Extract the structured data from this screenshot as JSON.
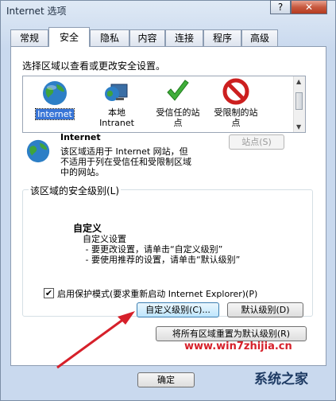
{
  "window": {
    "title": "Internet 选项",
    "help": "?",
    "close": "✕"
  },
  "tabs": [
    {
      "label": "常规"
    },
    {
      "label": "安全"
    },
    {
      "label": "隐私"
    },
    {
      "label": "内容"
    },
    {
      "label": "连接"
    },
    {
      "label": "程序"
    },
    {
      "label": "高级"
    }
  ],
  "active_tab": "安全",
  "zones": {
    "prompt": "选择区域以查看或更改安全设置。",
    "items": [
      {
        "label": "Internet",
        "icon": "globe-icon",
        "selected": true
      },
      {
        "label": "本地\nIntranet",
        "icon": "intranet-icon",
        "selected": false
      },
      {
        "label": "受信任的站\n点",
        "icon": "checkmark-icon",
        "selected": false
      },
      {
        "label": "受限制的站\n点",
        "icon": "no-entry-icon",
        "selected": false
      }
    ]
  },
  "zone_info": {
    "name": "Internet",
    "description": "该区域适用于 Internet 网站，但\n不适用于列在受信任和受限制区域\n中的网站。",
    "sites_button": "站点(S)"
  },
  "security_level": {
    "group_title": "该区域的安全级别(L)",
    "level_name": "自定义",
    "details": "自定义设置\n - 要更改设置，请单击“自定义级别”\n - 要使用推荐的设置，请单击“默认级别”",
    "protected_mode": "启用保护模式(要求重新启动 Internet Explorer)(P)",
    "protected_mode_checked": true,
    "custom_level_button": "自定义级别(C)...",
    "default_level_button": "默认级别(D)"
  },
  "reset_all_button": "将所有区域重置为默认级别(R)",
  "footer": {
    "ok_button": "确定"
  },
  "watermark": {
    "url": "www.win7zhijia.cn",
    "brand": "系统之家"
  },
  "colors": {
    "selection": "#3875d7",
    "close": "#c75a40",
    "arrow": "#d6202a"
  }
}
